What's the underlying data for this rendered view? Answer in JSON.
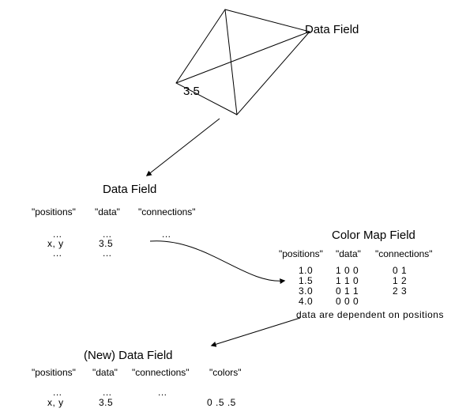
{
  "geom": {
    "label": "Data Field",
    "value": "3.5"
  },
  "data_field": {
    "title": "Data Field",
    "cols": {
      "positions": "\"positions\"",
      "data": "\"data\"",
      "connections": "\"connections\""
    },
    "row": {
      "positions": "x, y",
      "data": "3.5"
    },
    "ellipsis": "..."
  },
  "color_map": {
    "title": "Color Map Field",
    "cols": {
      "positions": "\"positions\"",
      "data": "\"data\"",
      "connections": "\"connections\""
    },
    "rows": [
      {
        "positions": "1.0",
        "data": "1 0 0",
        "connections": "0 1"
      },
      {
        "positions": "1.5",
        "data": "1 1 0",
        "connections": "1 2"
      },
      {
        "positions": "3.0",
        "data": "0 1 1",
        "connections": "2 3"
      },
      {
        "positions": "4.0",
        "data": "0 0 0",
        "connections": ""
      }
    ],
    "note": "data are dependent on positions"
  },
  "new_field": {
    "title": "(New) Data Field",
    "cols": {
      "positions": "\"positions\"",
      "data": "\"data\"",
      "connections": "\"connections\"",
      "colors": "\"colors\""
    },
    "row": {
      "positions": "x, y",
      "data": "3.5",
      "colors": "0 .5 .5"
    },
    "ellipsis": "..."
  }
}
